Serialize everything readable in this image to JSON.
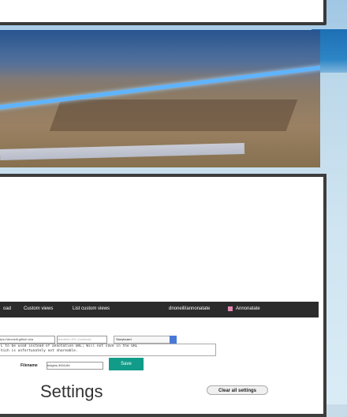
{
  "navbar": {
    "partial_item": "oad",
    "items": [
      "Custom views",
      "List custom views"
    ],
    "repo": "dnoneill/annonatate",
    "app_name": "Annonatate"
  },
  "form": {
    "url_value": "ttps://dnoneill.github.io/a",
    "bookmark_placeholder": "Manifest URL (Optional)",
    "view_select": "Storyboard",
    "notice": "L to be used instead of annotation URL; Will not save in the URL\nhich is unfortunately not shareable.",
    "filename_label": "Filename",
    "filename_value": "beigins-3004-fld",
    "save_label": "Save"
  },
  "settings": {
    "title": "Settings",
    "clear_label": "Clear all settings"
  },
  "colors": {
    "save_button": "#109c88",
    "navbar": "#2b2b2b",
    "beam": "#5fb4ff"
  }
}
